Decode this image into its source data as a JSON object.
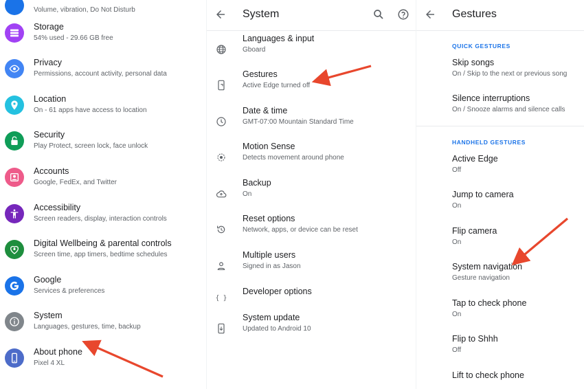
{
  "settings_main": {
    "partial_top_subtitle": "Volume, vibration, Do Not Disturb",
    "items": [
      {
        "title": "Storage",
        "subtitle": "54% used - 29.66 GB free",
        "color": "#a142f4",
        "icon": "storage-icon"
      },
      {
        "title": "Privacy",
        "subtitle": "Permissions, account activity, personal data",
        "color": "#4285f4",
        "icon": "eye-icon"
      },
      {
        "title": "Location",
        "subtitle": "On - 61 apps have access to location",
        "color": "#24c1e0",
        "icon": "location-pin-icon"
      },
      {
        "title": "Security",
        "subtitle": "Play Protect, screen lock, face unlock",
        "color": "#0f9d58",
        "icon": "lock-icon"
      },
      {
        "title": "Accounts",
        "subtitle": "Google, FedEx, and Twitter",
        "color": "#ee5b8a",
        "icon": "account-icon"
      },
      {
        "title": "Accessibility",
        "subtitle": "Screen readers, display, interaction controls",
        "color": "#7627bb",
        "icon": "accessibility-icon"
      },
      {
        "title": "Digital Wellbeing & parental controls",
        "subtitle": "Screen time, app timers, bedtime schedules",
        "color": "#1e8e3e",
        "icon": "heart-icon"
      },
      {
        "title": "Google",
        "subtitle": "Services & preferences",
        "color": "#1a73e8",
        "icon": "google-g-icon"
      },
      {
        "title": "System",
        "subtitle": "Languages, gestures, time, backup",
        "color": "#80868b",
        "icon": "info-icon"
      },
      {
        "title": "About phone",
        "subtitle": "Pixel 4 XL",
        "color": "#4d6cc9",
        "icon": "phone-icon"
      }
    ]
  },
  "system": {
    "title": "System",
    "back_icon": "arrow-left-icon",
    "search_icon": "search-icon",
    "help_icon": "help-icon",
    "items": [
      {
        "title": "Languages & input",
        "subtitle": "Gboard",
        "icon": "globe-icon"
      },
      {
        "title": "Gestures",
        "subtitle": "Active Edge turned off",
        "icon": "phone-gesture-icon"
      },
      {
        "title": "Date & time",
        "subtitle": "GMT-07:00 Mountain Standard Time",
        "icon": "clock-icon"
      },
      {
        "title": "Motion Sense",
        "subtitle": "Detects movement around phone",
        "icon": "motion-sense-icon"
      },
      {
        "title": "Backup",
        "subtitle": "On",
        "icon": "cloud-upload-icon"
      },
      {
        "title": "Reset options",
        "subtitle": "Network, apps, or device can be reset",
        "icon": "reset-icon"
      },
      {
        "title": "Multiple users",
        "subtitle": "Signed in as Jason",
        "icon": "person-icon"
      },
      {
        "title": "Developer options",
        "subtitle": "",
        "icon": "braces-icon"
      },
      {
        "title": "System update",
        "subtitle": "Updated to Android 10",
        "icon": "system-update-icon"
      }
    ]
  },
  "gestures": {
    "title": "Gestures",
    "back_icon": "arrow-left-icon",
    "quick_header": "QUICK GESTURES",
    "quick": [
      {
        "title": "Skip songs",
        "subtitle": "On / Skip to the next or previous song"
      },
      {
        "title": "Silence interruptions",
        "subtitle": "On / Snooze alarms and silence calls"
      }
    ],
    "handheld_header": "HANDHELD GESTURES",
    "handheld": [
      {
        "title": "Active Edge",
        "subtitle": "Off"
      },
      {
        "title": "Jump to camera",
        "subtitle": "On"
      },
      {
        "title": "Flip camera",
        "subtitle": "On"
      },
      {
        "title": "System navigation",
        "subtitle": "Gesture navigation"
      },
      {
        "title": "Tap to check phone",
        "subtitle": "On"
      },
      {
        "title": "Flip to Shhh",
        "subtitle": "Off"
      },
      {
        "title": "Lift to check phone",
        "subtitle": ""
      }
    ]
  },
  "colors": {
    "accent": "#1a73e8",
    "annotation_arrow": "#e8472d"
  }
}
